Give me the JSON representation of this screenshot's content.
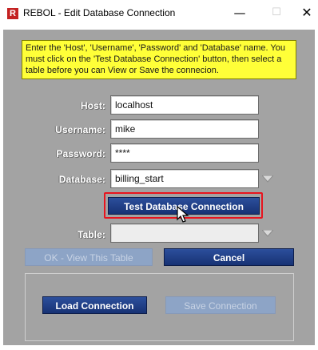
{
  "window": {
    "app_icon_letter": "R",
    "title": "REBOL - Edit Database Connection",
    "controls": {
      "minimize": "—",
      "maximize": "☐",
      "close": "✕"
    }
  },
  "notice": "Enter the 'Host', 'Username', 'Password' and 'Database' name. You must click on the 'Test Database Connection' button, then select a table before you can View or Save the connecion.",
  "form": {
    "host": {
      "label": "Host:",
      "value": "localhost"
    },
    "username": {
      "label": "Username:",
      "value": "mike"
    },
    "password": {
      "label": "Password:",
      "value": "****"
    },
    "database": {
      "label": "Database:",
      "value": "billing_start"
    },
    "table": {
      "label": "Table:",
      "value": ""
    }
  },
  "buttons": {
    "test_connection": "Test Database Connection",
    "view_table": "OK - View This Table",
    "cancel": "Cancel",
    "load_connection": "Load Connection",
    "save_connection": "Save Connection"
  },
  "colors": {
    "client_bg": "#a3a3a3",
    "notice_bg": "#ffff38",
    "primary_button": "#1f3f87",
    "focus_ring": "#e8141e"
  },
  "icons": [
    "app-icon",
    "minimize-icon",
    "maximize-icon",
    "close-icon",
    "dropdown-arrow-icon",
    "mouse-cursor-icon"
  ]
}
